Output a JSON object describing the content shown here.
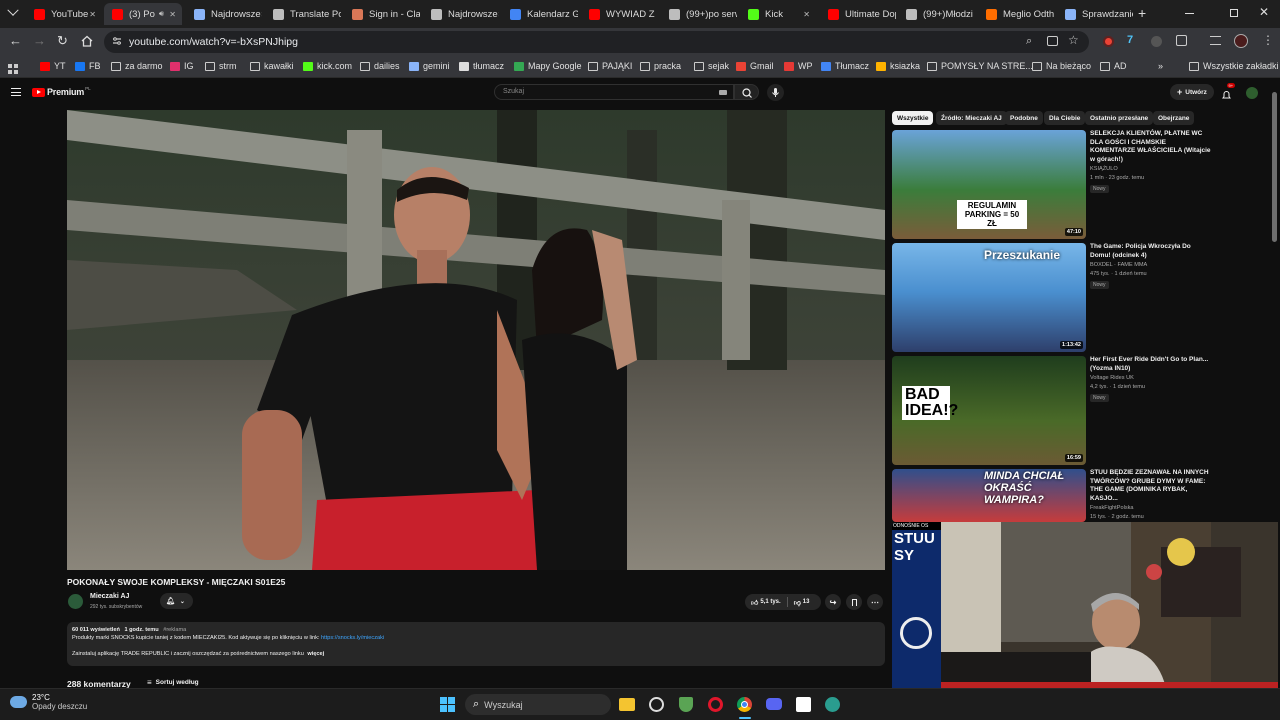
{
  "browser": {
    "tabs": [
      {
        "label": "YouTube",
        "color": "#ff0000"
      },
      {
        "label": "(3) Po",
        "color": "#ff0000",
        "active": true
      },
      {
        "label": "Najdrowsze",
        "color": "#8ab4f8"
      },
      {
        "label": "Translate Poli",
        "color": "#bdbdbd"
      },
      {
        "label": "Sign in - Clau",
        "color": "#d97757"
      },
      {
        "label": "Najdrowsze",
        "color": "#bdbdbd"
      },
      {
        "label": "Kalendarz Go",
        "color": "#4285f4"
      },
      {
        "label": "WYWIAD Z M",
        "color": "#ff0000"
      },
      {
        "label": "(99+)po serw",
        "color": "#bdbdbd"
      },
      {
        "label": "Kick",
        "color": "#53fc18"
      },
      {
        "label": "Ultimate Dop",
        "color": "#ff0000"
      },
      {
        "label": "(99+)Młodzi",
        "color": "#bdbdbd"
      },
      {
        "label": "Meglio Odth",
        "color": "#ff6d00"
      },
      {
        "label": "Sprawdzanie",
        "color": "#8ab4f8"
      }
    ],
    "new_tab": "+",
    "url": "youtube.com/watch?v=-bXsPNJhipg",
    "bookmarks": [
      "YT",
      "FB",
      "za darmo",
      "IG",
      "strm",
      "kawałki",
      "kick.com",
      "dailies",
      "gemini",
      "tłumacz",
      "Mapy Google",
      "PAJĄKI",
      "pracka",
      "sejak",
      "Gmail",
      "WP",
      "Tłumacz",
      "ksiazka",
      "POMYSŁY NA STRE...",
      "Na bieżąco",
      "AD"
    ],
    "bookmarks_more": "»",
    "all_bookmarks": "Wszystkie zakładki"
  },
  "youtube": {
    "logo": "Premium",
    "logo_region": "PL",
    "search_placeholder": "Szukaj",
    "create_label": "Utwórz",
    "notification_count": "9+",
    "video": {
      "title": "POKONAŁY SWOJE KOMPLEKSY - MIĘCZAKI S01E25",
      "channel": "Mieczaki AJ",
      "subscribers": "292 tys. subskrybentów",
      "likes": "5,1 tys.",
      "dislikes": "13",
      "views": "60 011 wyświetleń",
      "posted": "1 godz. temu",
      "hashtag": "#reklama",
      "desc_line1": "Produkty marki SNOCKS kupicie taniej z kodem MIECZAKI25. Kod aktywuje się po kliknięciu w link:",
      "desc_link": "https://snocks.ly/mieczaki",
      "desc_line2": "Zainstaluj aplikację TRADE REPUBLIC i zacznij oszczędzać za pośrednictwem naszego linku",
      "more": "więcej",
      "comments_count": "288 komentarzy",
      "sort_label": "Sortuj według"
    },
    "chips": [
      "Wszystkie",
      "Źródło: Mieczaki AJ",
      "Podobne",
      "Dla Ciebie",
      "Ostatnio przesłane",
      "Obejrzane"
    ],
    "recommendations": [
      {
        "title": "SELEKCJA KLIENTÓW, PŁATNE WC DLA GOŚCI I CHAMSKIE KOMENTARZE WŁAŚCICIELA (Witajcie w górach!)",
        "channel": "KSIĄŻULO",
        "meta": "1 mln · 23 godz. temu",
        "badge": "Nowy",
        "duration": "47:10",
        "thumb_text": "REGULAMIN PARKING = 50 ZŁ"
      },
      {
        "title": "The Game: Policja Wkroczyła Do Domu! (odcinek 4)",
        "channel": "BOXDEL · FAME MMA",
        "meta": "475 tys. · 1 dzień temu",
        "badge": "Nowy",
        "duration": "1:13:42",
        "thumb_text": "Przeszukanie"
      },
      {
        "title": "Her First Ever Ride Didn't Go to Plan... (Yozma IN10)",
        "channel": "Voltage Rides UK",
        "meta": "4,2 tys. · 1 dzień temu",
        "badge": "Nowy",
        "duration": "16:59",
        "thumb_text": "BAD IDEA!?"
      },
      {
        "title": "STUU BĘDZIE ZEZNAWAŁ NA INNYCH TWÓRCÓW? GRUBE DYMY W FAME: THE GAME (DOMINIKA RYBAK, KASJO...",
        "channel": "FreakFightPolska",
        "meta": "15 tys. · 2 godz. temu",
        "badge": "Nowy",
        "duration": "",
        "thumb_text": "MINDA CHCIAŁ OKRAŚĆ WAMPIRA?"
      }
    ],
    "partial_thumb_text": "STUU SY",
    "partial_thumb_caption": "ODNOŚNIE OS"
  },
  "taskbar": {
    "temperature": "23°C",
    "weather": "Opady deszczu",
    "search_placeholder": "Wyszukaj"
  }
}
